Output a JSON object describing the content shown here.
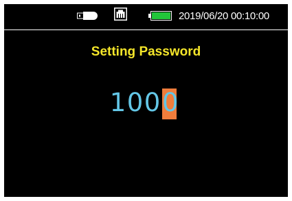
{
  "status_bar": {
    "icons": [
      "usb-drive-icon",
      "lan-port-icon",
      "battery-full-icon"
    ],
    "datetime": "2019/06/20 00:10:00"
  },
  "screen": {
    "title": "Setting Password",
    "password_digits": [
      "1",
      "0",
      "0",
      "0"
    ],
    "cursor_index": 3
  },
  "colors": {
    "background": "#000000",
    "title": "#f5e62a",
    "digits": "#63c6e6",
    "cursor": "#f07d3c",
    "battery": "#22c63a",
    "status_text": "#ffffff"
  }
}
